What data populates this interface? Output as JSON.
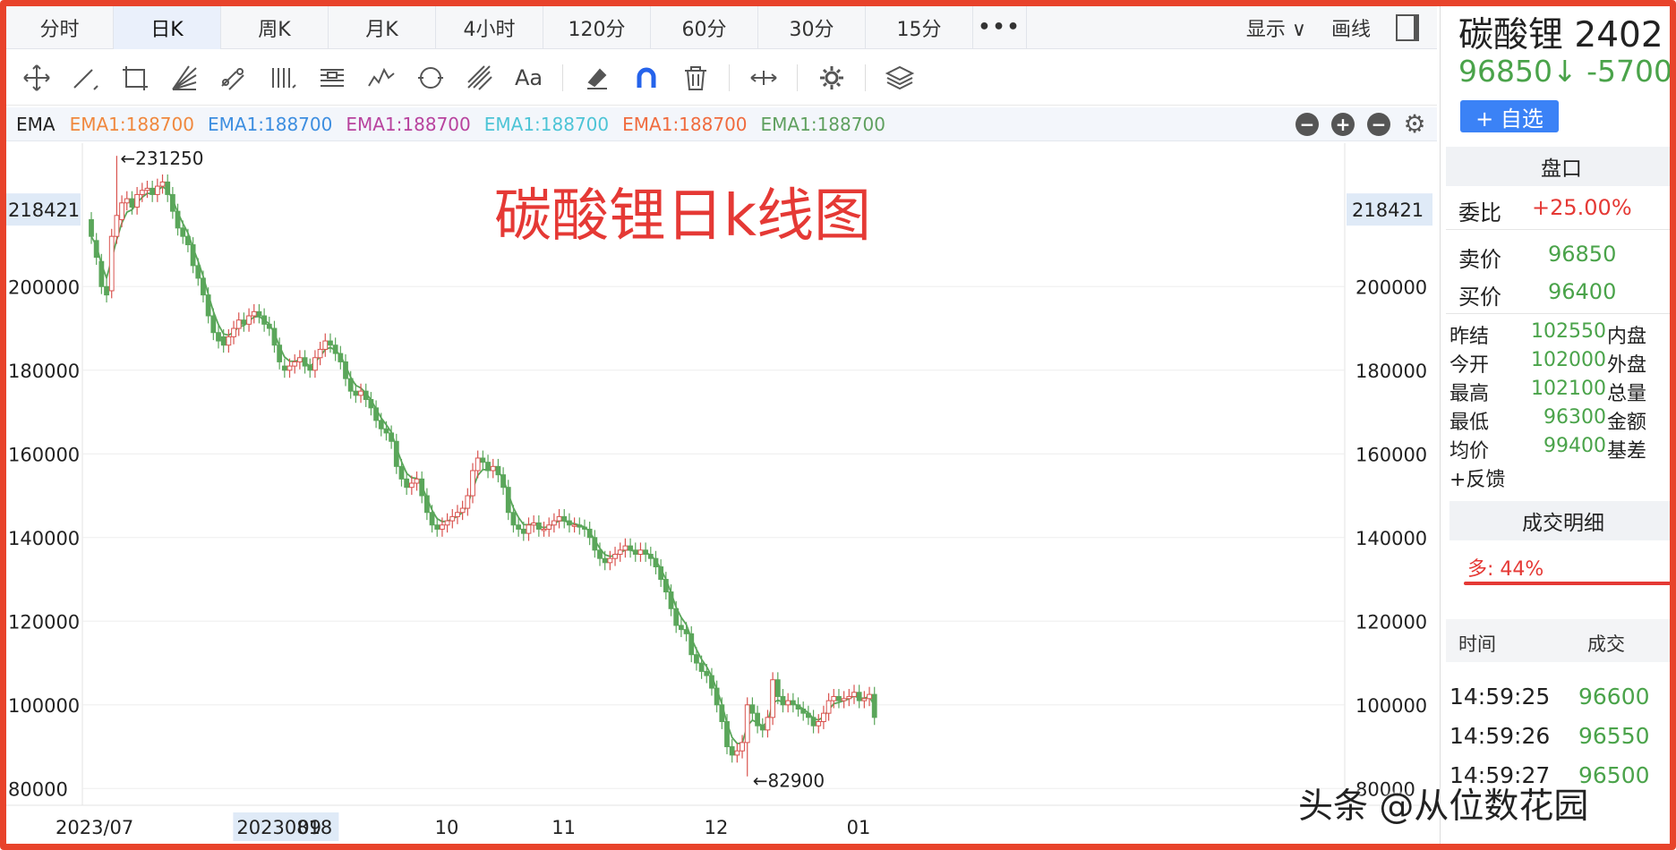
{
  "tabs": [
    {
      "label": "分时",
      "active": false
    },
    {
      "label": "日K",
      "active": true
    },
    {
      "label": "周K",
      "active": false
    },
    {
      "label": "月K",
      "active": false
    },
    {
      "label": "4小时",
      "active": false
    },
    {
      "label": "120分",
      "active": false
    },
    {
      "label": "60分",
      "active": false
    },
    {
      "label": "30分",
      "active": false
    },
    {
      "label": "15分",
      "active": false
    }
  ],
  "tabs_more": "•••",
  "tabs_right": {
    "display_label": "显示",
    "display_arrow": "∨",
    "draw_label": "画线"
  },
  "toolbar": {
    "font_tool_label": "Aa"
  },
  "ema": {
    "title": "EMA",
    "items": [
      {
        "label": "EMA1:188700",
        "color": "#f0883e"
      },
      {
        "label": "EMA1:188700",
        "color": "#3d8ee0"
      },
      {
        "label": "EMA1:188700",
        "color": "#b8439e"
      },
      {
        "label": "EMA1:188700",
        "color": "#4dc4d6"
      },
      {
        "label": "EMA1:188700",
        "color": "#f06b3e"
      },
      {
        "label": "EMA1:188700",
        "color": "#5fa05f"
      }
    ]
  },
  "chart_data": {
    "type": "candlestick",
    "annotation": "碳酸锂日k线图",
    "y_ticks": [
      80000,
      100000,
      120000,
      140000,
      160000,
      180000,
      200000
    ],
    "current_price_label": "218421",
    "current_price_value": 218421,
    "ylim": [
      76000,
      233000
    ],
    "x_labels": [
      {
        "label": "2023/07",
        "index": 0,
        "highlight": false
      },
      {
        "label": "20230818",
        "index": 30,
        "highlight": true
      },
      {
        "label": "09",
        "index": 43,
        "highlight": false
      },
      {
        "label": "10",
        "index": 70,
        "highlight": false
      },
      {
        "label": "11",
        "index": 93,
        "highlight": false
      },
      {
        "label": "12",
        "index": 123,
        "highlight": false
      },
      {
        "label": "01",
        "index": 151,
        "highlight": false
      }
    ],
    "high_marker": {
      "label": "←231250",
      "value": 231250,
      "index": 5
    },
    "low_marker": {
      "label": "←82900",
      "value": 82900,
      "index": 129
    },
    "up_color": "#d9534f",
    "down_color": "#5aa65a",
    "ema_color": "#5aa65a",
    "closes": [
      212000,
      207000,
      200000,
      198000,
      212000,
      217000,
      220000,
      221000,
      219000,
      222000,
      223000,
      223500,
      222000,
      224000,
      225000,
      222000,
      218000,
      214000,
      212000,
      210000,
      205000,
      202000,
      198000,
      193000,
      189000,
      187000,
      186000,
      188000,
      190000,
      192000,
      191000,
      193000,
      194000,
      193000,
      191000,
      190000,
      186000,
      182000,
      180000,
      181000,
      182000,
      183000,
      181000,
      180000,
      183000,
      185000,
      187000,
      186000,
      184000,
      182000,
      178000,
      175000,
      174000,
      175000,
      173000,
      171000,
      168000,
      166000,
      165000,
      163000,
      157000,
      154000,
      152000,
      153000,
      154000,
      150000,
      146000,
      143000,
      142000,
      143000,
      144000,
      145000,
      146000,
      147000,
      150000,
      156000,
      159000,
      158000,
      156000,
      157000,
      155000,
      152000,
      146000,
      143000,
      142000,
      141000,
      143000,
      143500,
      142000,
      142000,
      143000,
      144000,
      145000,
      144000,
      143000,
      143000,
      142500,
      142000,
      140000,
      137000,
      135000,
      134000,
      135000,
      136000,
      137000,
      138000,
      137000,
      136000,
      137000,
      136000,
      135000,
      133000,
      130000,
      127000,
      123000,
      119000,
      118000,
      117000,
      112000,
      110000,
      108000,
      107000,
      104000,
      100000,
      96000,
      90000,
      88000,
      89000,
      91000,
      100000,
      98000,
      95000,
      94000,
      97000,
      106000,
      102000,
      100000,
      101000,
      100000,
      99000,
      98000,
      97000,
      95000,
      96000,
      98000,
      101000,
      102000,
      101000,
      101500,
      102000,
      103000,
      101000,
      101500,
      102500,
      97000
    ],
    "opens": [
      216000,
      211000,
      206000,
      200000,
      199000,
      212000,
      216000,
      220000,
      221000,
      219000,
      222000,
      223000,
      223500,
      222000,
      224000,
      225000,
      222000,
      218000,
      214000,
      212000,
      210000,
      205000,
      202000,
      198000,
      193000,
      189000,
      188000,
      186000,
      188000,
      190000,
      192000,
      191000,
      193000,
      194000,
      193000,
      191000,
      190000,
      186000,
      181000,
      180000,
      181000,
      182000,
      183000,
      181000,
      180000,
      183000,
      185000,
      187000,
      186000,
      184000,
      182000,
      178000,
      175000,
      174000,
      175000,
      173000,
      171000,
      168000,
      166000,
      165000,
      163000,
      157000,
      154000,
      152000,
      153000,
      154000,
      150000,
      146000,
      143000,
      142000,
      143000,
      144000,
      145000,
      146000,
      147000,
      150000,
      156000,
      159000,
      158000,
      156000,
      157000,
      155000,
      152000,
      146000,
      143000,
      142000,
      141000,
      143000,
      143500,
      142000,
      142000,
      143000,
      144000,
      145000,
      144000,
      143000,
      143000,
      142500,
      142000,
      140000,
      137000,
      135000,
      134000,
      135000,
      136000,
      137000,
      138000,
      137000,
      136000,
      137000,
      136000,
      135000,
      133000,
      130000,
      127000,
      123000,
      119000,
      118000,
      117000,
      112000,
      110000,
      108000,
      107000,
      104000,
      100000,
      96000,
      90000,
      88000,
      89000,
      91000,
      100000,
      98000,
      95000,
      94000,
      97000,
      106000,
      102000,
      100000,
      101000,
      100000,
      99000,
      98000,
      97000,
      95000,
      96000,
      98000,
      101000,
      102000,
      101000,
      101500,
      102000,
      103000,
      101000,
      101500,
      102500
    ]
  },
  "panel": {
    "title": "碳酸锂 2402",
    "price": "96850↓ -5700",
    "add_label": "+ 自选",
    "pankou_label": "盘口",
    "weibi_label": "委比",
    "weibi_value": "+25.00%",
    "sell_label": "卖价",
    "sell_value": "96850",
    "buy_label": "买价",
    "buy_value": "96400",
    "quotes": [
      {
        "label": "昨结",
        "value": "102550",
        "right": "内盘"
      },
      {
        "label": "今开",
        "value": "102000",
        "right": "外盘"
      },
      {
        "label": "最高",
        "value": "102100",
        "right": "总量"
      },
      {
        "label": "最低",
        "value": "96300",
        "right": "金额"
      },
      {
        "label": "均价",
        "value": "99400",
        "right": "基差"
      }
    ],
    "feedback_label": "+反馈",
    "detail_label": "成交明细",
    "ratio_label": "多: 44%",
    "trade_head": {
      "time": "时间",
      "price": "成交"
    },
    "trades": [
      {
        "time": "14:59:25",
        "price": "96600"
      },
      {
        "time": "14:59:26",
        "price": "96550"
      },
      {
        "time": "14:59:27",
        "price": "96500"
      }
    ]
  },
  "watermark": "头条 @从位数花园"
}
